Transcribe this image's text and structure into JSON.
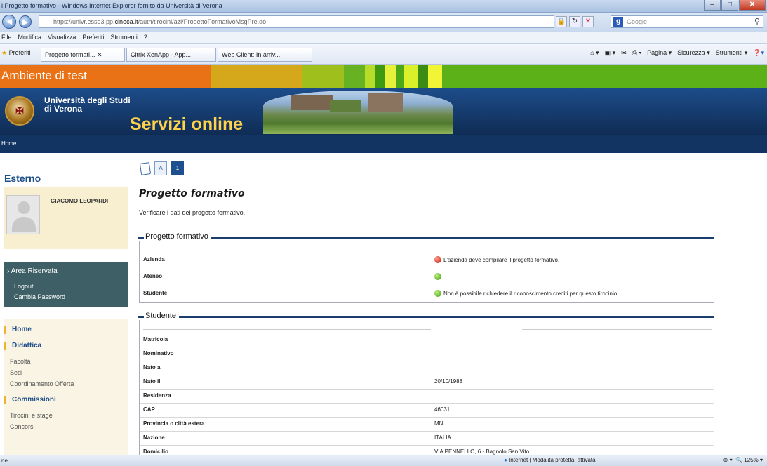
{
  "browser": {
    "window_title": "l Progetto formativo - Windows Internet Explorer fornito da Università di Verona",
    "url_prefix": "https://univr.esse3.pp.",
    "url_domain": "cineca.it",
    "url_path": "/auth/tirocini/azi/ProgettoFormativoMsgPre.do",
    "search_placeholder": "Google",
    "menu": [
      "File",
      "Modifica",
      "Visualizza",
      "Preferiti",
      "Strumenti",
      "?"
    ],
    "favorites_label": "Preferiti",
    "tabs": [
      "Progetto formati...",
      "Citrix XenApp - App...",
      "Web Client: In arriv..."
    ],
    "tools": [
      "Pagina ▾",
      "Sicurezza ▾",
      "Strumenti ▾"
    ],
    "status_left": "ne",
    "status_zone": "Internet | Modalità protetta: attivata",
    "zoom": "125%"
  },
  "header": {
    "env_label": "Ambiente di test",
    "university_line1": "Università degli Studi",
    "university_line2": "di Verona",
    "services_title": "Servizi online",
    "home_link": "Home"
  },
  "sidebar": {
    "section_title": "Esterno",
    "user_name": "GIACOMO LEOPARDI",
    "area_title": "Area Riservata",
    "area_links": [
      "Logout",
      "Cambia Password"
    ],
    "menu": {
      "home": "Home",
      "didattica": "Didattica",
      "didattica_items": [
        "Facoltà",
        "Sedi",
        "Coordinamento Offerta"
      ],
      "commissioni": "Commissioni",
      "commissioni_items": [
        "Tirocini e stage",
        "Concorsi"
      ]
    }
  },
  "content": {
    "steps": [
      "A",
      "1"
    ],
    "title": "Progetto formativo",
    "description": "Verificare i dati del progetto formativo.",
    "progetto": {
      "legend": "Progetto formativo",
      "rows": [
        {
          "label": "Azienda",
          "status": "red",
          "value": "L'azienda deve compilare il progetto formativo."
        },
        {
          "label": "Ateneo",
          "status": "green",
          "value": ""
        },
        {
          "label": "Studente",
          "status": "green",
          "value": "Non è possibile richiedere il riconoscimento crediti per questo tirocinio."
        }
      ]
    },
    "studente": {
      "legend": "Studente",
      "rows": [
        {
          "label": "Matricola",
          "value": ""
        },
        {
          "label": "Nominativo",
          "value": ""
        },
        {
          "label": "Nato a",
          "value": ""
        },
        {
          "label": "Nato il",
          "value": "20/10/1988"
        },
        {
          "label": "Residenza",
          "value": ""
        },
        {
          "label": "CAP",
          "value": "46031"
        },
        {
          "label": "Provincia o città estera",
          "value": "MN"
        },
        {
          "label": "Nazione",
          "value": "ITALIA"
        },
        {
          "label": "Domicilio",
          "value": "VIA PENNELLO, 6 - Bagnolo San Vito"
        }
      ]
    }
  },
  "colors": {
    "env_bar": "#ea7216",
    "banner_blue": "#123462",
    "services_yellow": "#ffd24a",
    "status_red": "#c41a0a",
    "status_green": "#3f9a12"
  }
}
